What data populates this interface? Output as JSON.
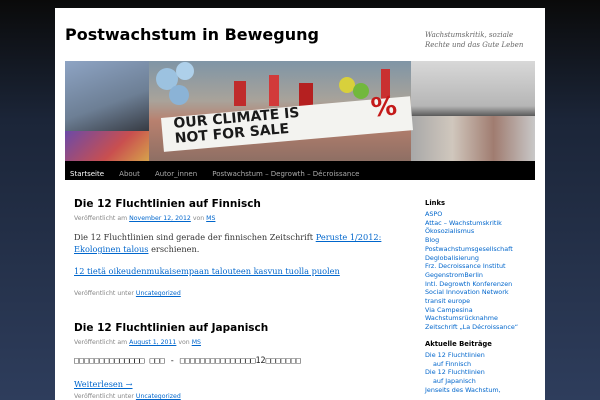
{
  "site": {
    "title": "Postwachstum in Bewegung",
    "description": "Wachstumskritik, soziale Rechte und das Gute Leben"
  },
  "banner": {
    "sign_line1": "OUR CLIMATE IS",
    "sign_line2": "NOT FOR SALE",
    "sign_percent": "%",
    "colors": {
      "sign_bg": "#f3f3f0",
      "sign_red": "#c41a1a"
    }
  },
  "nav": {
    "items": [
      {
        "label": "Startseite",
        "current": true
      },
      {
        "label": "About"
      },
      {
        "label": "Autor_innen"
      },
      {
        "label": "Postwachstum – Degrowth – Décroissance"
      }
    ]
  },
  "posts": [
    {
      "title": "Die 12 Fluchtlinien auf Finnisch",
      "meta_prefix": "Veröffentlicht am",
      "date": "November 12, 2012",
      "by": "von",
      "author": "MS",
      "body_before": "Die 12 Fluchtlinien sind gerade der finnischen Zeitschrift ",
      "body_link": "Peruste 1/2012: Ekologinen talous",
      "body_after": " erschienen.",
      "second_link": "12 tietä oikeudenmukaisempaan talouteen kasvun tuolla puolen",
      "footer_prefix": "Veröffentlicht unter",
      "category": "Uncategorized"
    },
    {
      "title": "Die 12 Fluchtlinien auf Japanisch",
      "meta_prefix": "Veröffentlicht am",
      "date": "August 1, 2011",
      "by": "von",
      "author": "MS",
      "body_text": "□□□□□□□□□□□□□□ □□□ - □□□□□□□□□□□□□□□12□□□□□□□",
      "read_more": "Weiterlesen →",
      "footer_prefix": "Veröffentlicht unter",
      "category": "Uncategorized"
    }
  ],
  "sidebar": {
    "links_title": "Links",
    "links": [
      "ASPO",
      "Attac – Wachstumskritik",
      "Ökosozialismus",
      "Blog",
      "Postwachstumsgesellschaft",
      "Deglobalisierung",
      "Frz. Decroissance Institut",
      "GegenstromBerlin",
      "Intl. Degrowth Konferenzen",
      "Social Innovation Network",
      "transit europe",
      "Via Campesina",
      "Wachstumsrücknahme",
      "Zeitschrift „La Décroissance“"
    ],
    "recent_title": "Aktuelle Beiträge",
    "recent": [
      {
        "line1": "Die 12 Fluchtlinien",
        "line2": "auf Finnisch"
      },
      {
        "line1": "Die 12 Fluchtlinien",
        "line2": "auf Japanisch"
      },
      {
        "line1": "Jenseits des Wachstum,",
        "line2": ""
      }
    ]
  }
}
